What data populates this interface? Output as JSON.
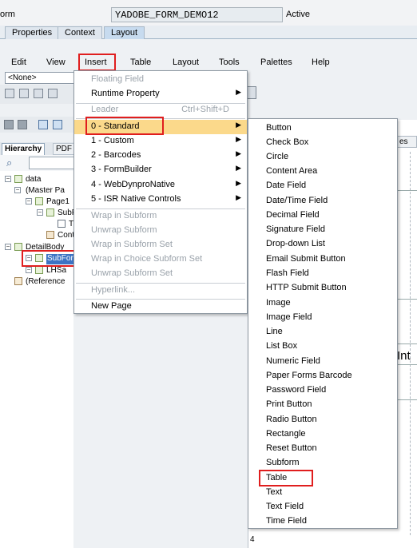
{
  "header": {
    "form_label": "orm",
    "form_name": "YADOBE_FORM_DEMO12",
    "status": "Active"
  },
  "tabs": [
    "Properties",
    "Context",
    "Layout"
  ],
  "menubar": [
    "Edit",
    "View",
    "Insert",
    "Table",
    "Layout",
    "Tools",
    "Palettes",
    "Help"
  ],
  "toolbar": {
    "combo_value": "<None>"
  },
  "hierarchy": {
    "tab_label": "Hierarchy",
    "pdf_tab_label": "PDF",
    "tree": {
      "data": "data",
      "master_pages": "(Master Pa",
      "page1": "Page1",
      "subform_a": "SubF",
      "text_a": "T",
      "content": "Cont",
      "detail_body": "DetailBody",
      "subform_selected": "SubForm",
      "lhs": "LHSa",
      "referenced": "(Reference"
    }
  },
  "insert_menu": {
    "items": [
      {
        "label": "Floating Field",
        "disabled": true
      },
      {
        "label": "Runtime Property",
        "submenu": true
      },
      {
        "label": "Leader",
        "shortcut": "Ctrl+Shift+D",
        "disabled": true
      },
      {
        "label": "0 - Standard",
        "submenu": true,
        "selected": true
      },
      {
        "label": "1 - Custom",
        "submenu": true
      },
      {
        "label": "2 - Barcodes",
        "submenu": true
      },
      {
        "label": "3 - FormBuilder",
        "submenu": true
      },
      {
        "label": "4 - WebDynproNative",
        "submenu": true
      },
      {
        "label": "5 - ISR Native Controls",
        "submenu": true
      },
      {
        "label": "Wrap in Subform",
        "disabled": true
      },
      {
        "label": "Unwrap Subform",
        "disabled": true
      },
      {
        "label": "Wrap in Subform Set",
        "disabled": true
      },
      {
        "label": "Wrap in Choice Subform Set",
        "disabled": true
      },
      {
        "label": "Unwrap Subform Set",
        "disabled": true
      },
      {
        "label": "Hyperlink...",
        "disabled": true
      },
      {
        "label": "New Page"
      }
    ]
  },
  "standard_menu": {
    "items": [
      "Button",
      "Check Box",
      "Circle",
      "Content Area",
      "Date Field",
      "Date/Time Field",
      "Decimal Field",
      "Signature Field",
      "Drop-down List",
      "Email Submit Button",
      "Flash Field",
      "HTTP Submit Button",
      "Image",
      "Image Field",
      "Line",
      "List Box",
      "Numeric Field",
      "Paper Forms Barcode",
      "Password Field",
      "Print Button",
      "Radio Button",
      "Rectangle",
      "Reset Button",
      "Subform",
      "Table",
      "Text",
      "Text Field",
      "Time Field"
    ]
  },
  "canvas": {
    "tab_label": "es",
    "int_label": "Int",
    "row_number": "4"
  },
  "colors": {
    "highlight_box": "#e01e1e",
    "menu_selection": "#fbd98b",
    "tree_selection": "#3c73c4"
  }
}
